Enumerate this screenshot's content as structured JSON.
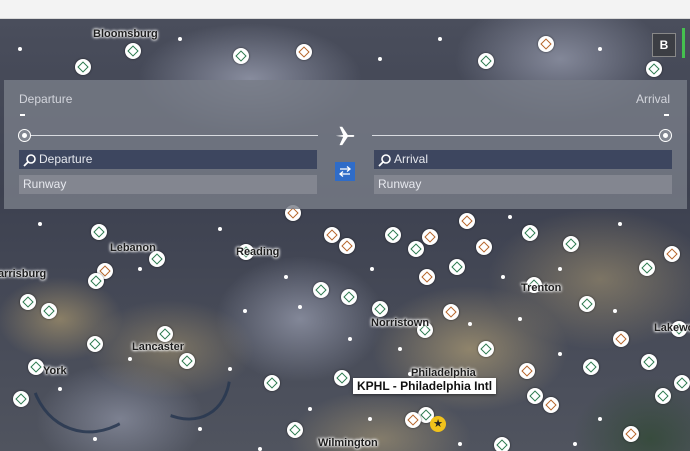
{
  "map": {
    "cities": [
      "Bloomsburg",
      "Lebanon",
      "Reading",
      "Harrisburg",
      "Lancaster",
      "York",
      "Norristown",
      "Philadelphia",
      "Trenton",
      "Lakewood",
      "Wilmington"
    ],
    "tooltip": "KPHL - Philadelphia Intl",
    "tooltip_colors": {
      "pin": "#2d7a4f",
      "pin_alt": "#b5652a",
      "star": "#f1c21b"
    }
  },
  "controls": {
    "map_layer_button": "B"
  },
  "flight_panel": {
    "departure_label": "Departure",
    "arrival_label": "Arrival",
    "departure_code": "-",
    "arrival_code": "-",
    "departure_search_placeholder": "Departure",
    "arrival_search_placeholder": "Arrival",
    "departure_runway_placeholder": "Runway",
    "arrival_runway_placeholder": "Runway",
    "icons": [
      "plane-icon",
      "swap-icon",
      "search-icon"
    ],
    "accent_color": "#2f6cc8"
  }
}
